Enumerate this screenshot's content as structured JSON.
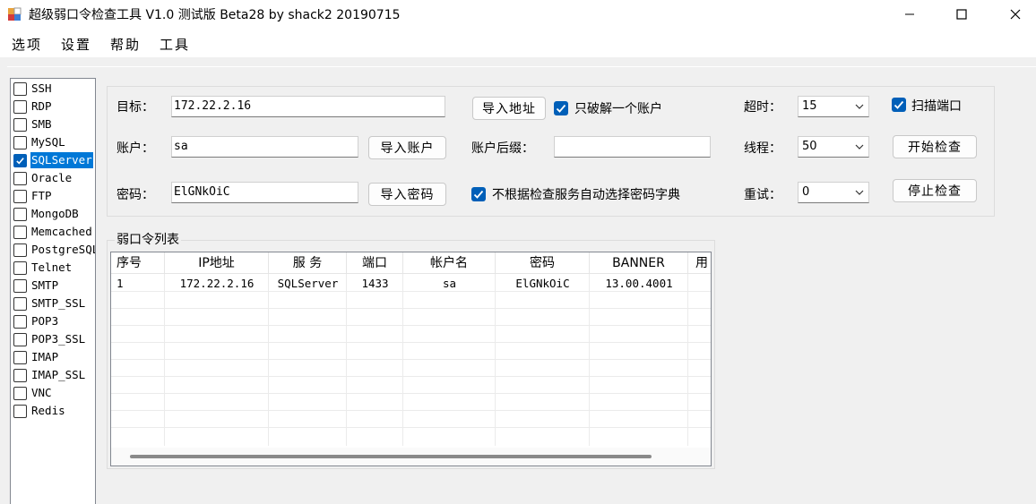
{
  "window": {
    "title": "超级弱口令检查工具 V1.0 测试版 Beta28 by shack2 20190715"
  },
  "menu": [
    "选项",
    "设置",
    "帮助",
    "工具"
  ],
  "services": [
    {
      "label": "SSH",
      "checked": false
    },
    {
      "label": "RDP",
      "checked": false
    },
    {
      "label": "SMB",
      "checked": false
    },
    {
      "label": "MySQL",
      "checked": false
    },
    {
      "label": "SQLServer",
      "checked": true,
      "selected": true
    },
    {
      "label": "Oracle",
      "checked": false
    },
    {
      "label": "FTP",
      "checked": false
    },
    {
      "label": "MongoDB",
      "checked": false
    },
    {
      "label": "Memcached",
      "checked": false
    },
    {
      "label": "PostgreSQL",
      "checked": false
    },
    {
      "label": "Telnet",
      "checked": false
    },
    {
      "label": "SMTP",
      "checked": false
    },
    {
      "label": "SMTP_SSL",
      "checked": false
    },
    {
      "label": "POP3",
      "checked": false
    },
    {
      "label": "POP3_SSL",
      "checked": false
    },
    {
      "label": "IMAP",
      "checked": false
    },
    {
      "label": "IMAP_SSL",
      "checked": false
    },
    {
      "label": "VNC",
      "checked": false
    },
    {
      "label": "Redis",
      "checked": false
    }
  ],
  "config": {
    "target_label": "目标：",
    "target_value": "172.22.2.16",
    "import_address_btn": "导入地址",
    "only_one_account_label": "只破解一个账户",
    "only_one_account_checked": true,
    "account_label": "账户：",
    "account_value": "sa",
    "import_account_btn": "导入账户",
    "account_suffix_label": "账户后缀：",
    "account_suffix_value": "",
    "password_label": "密码：",
    "password_value": "ElGNkOiC",
    "import_password_btn": "导入密码",
    "auto_dict_label": "不根据检查服务自动选择密码字典",
    "auto_dict_checked": true,
    "timeout_label": "超时：",
    "timeout_value": "15",
    "threads_label": "线程：",
    "threads_value": "50",
    "retry_label": "重试：",
    "retry_value": "0",
    "scan_port_label": "扫描端口",
    "scan_port_checked": true,
    "start_btn": "开始检查",
    "stop_btn": "停止检查"
  },
  "results": {
    "group_title": "弱口令列表",
    "columns": [
      "序号",
      "IP地址",
      "服 务",
      "端口",
      "帐户名",
      "密码",
      "BANNER",
      "用"
    ],
    "rows": [
      [
        "1",
        "172.22.2.16",
        "SQLServer",
        "1433",
        "sa",
        "ElGNkOiC",
        "13.00.4001",
        ""
      ]
    ]
  }
}
